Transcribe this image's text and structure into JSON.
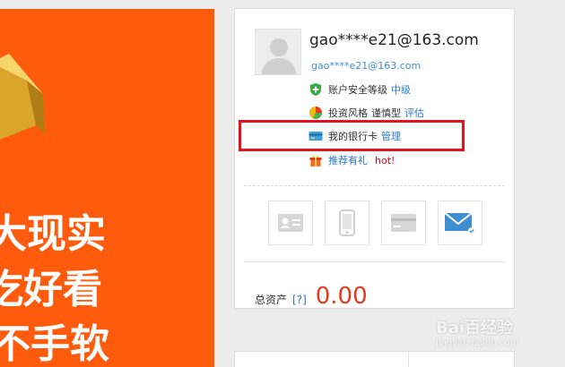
{
  "banner": {
    "line1": "大现实",
    "line2": "吃好看",
    "line3": "不手软"
  },
  "profile": {
    "username": "gao****e21@163.com",
    "email": "gao****e21@163.com"
  },
  "info_rows": {
    "security_label": "账户安全等级",
    "security_value": "中级",
    "risk_label": "投资风格",
    "risk_value": "谨慎型",
    "risk_link": "评估",
    "bank_label": "我的银行卡",
    "bank_link": "管理",
    "referral_link": "推荐有礼",
    "referral_badge": "hot!"
  },
  "assets": {
    "label": "总资产",
    "help": "[?]",
    "amount": "0.00"
  },
  "watermark": {
    "text": "Bai百经验",
    "subtext": "jingyan.baidu.com"
  },
  "colors": {
    "accent": "#ff5b0d",
    "link": "#2a78c8",
    "amount": "#e63a1f",
    "highlight": "#e3121c"
  },
  "icons": {
    "security": "shield-plus-icon",
    "risk": "pie-chart-icon",
    "bank": "bank-card-icon",
    "referral": "gift-icon",
    "quick_actions": [
      "id-card-icon",
      "phone-icon",
      "bank-card-icon",
      "mail-icon"
    ]
  }
}
